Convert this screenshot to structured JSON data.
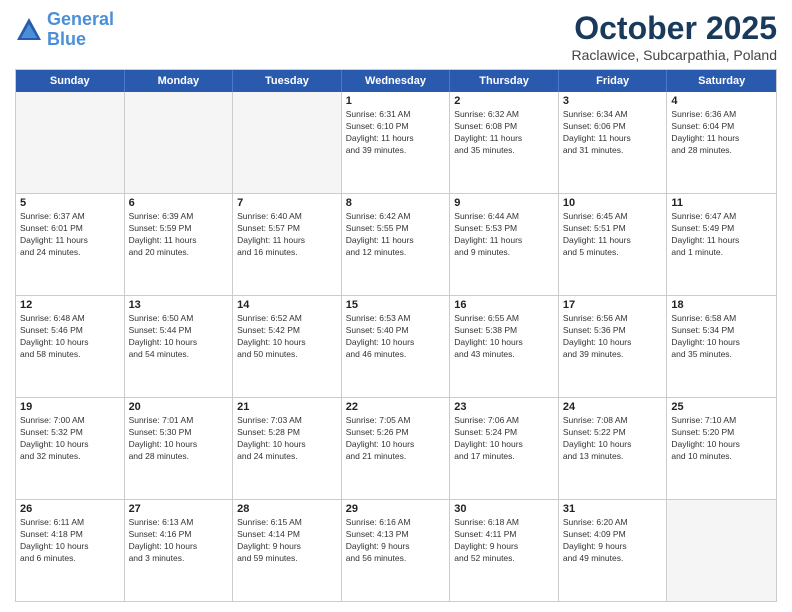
{
  "header": {
    "logo_line1": "General",
    "logo_line2": "Blue",
    "month": "October 2025",
    "location": "Raclawice, Subcarpathia, Poland"
  },
  "days_of_week": [
    "Sunday",
    "Monday",
    "Tuesday",
    "Wednesday",
    "Thursday",
    "Friday",
    "Saturday"
  ],
  "weeks": [
    [
      {
        "day": "",
        "info": "",
        "empty": true
      },
      {
        "day": "",
        "info": "",
        "empty": true
      },
      {
        "day": "",
        "info": "",
        "empty": true
      },
      {
        "day": "1",
        "info": "Sunrise: 6:31 AM\nSunset: 6:10 PM\nDaylight: 11 hours\nand 39 minutes."
      },
      {
        "day": "2",
        "info": "Sunrise: 6:32 AM\nSunset: 6:08 PM\nDaylight: 11 hours\nand 35 minutes."
      },
      {
        "day": "3",
        "info": "Sunrise: 6:34 AM\nSunset: 6:06 PM\nDaylight: 11 hours\nand 31 minutes."
      },
      {
        "day": "4",
        "info": "Sunrise: 6:36 AM\nSunset: 6:04 PM\nDaylight: 11 hours\nand 28 minutes."
      }
    ],
    [
      {
        "day": "5",
        "info": "Sunrise: 6:37 AM\nSunset: 6:01 PM\nDaylight: 11 hours\nand 24 minutes."
      },
      {
        "day": "6",
        "info": "Sunrise: 6:39 AM\nSunset: 5:59 PM\nDaylight: 11 hours\nand 20 minutes."
      },
      {
        "day": "7",
        "info": "Sunrise: 6:40 AM\nSunset: 5:57 PM\nDaylight: 11 hours\nand 16 minutes."
      },
      {
        "day": "8",
        "info": "Sunrise: 6:42 AM\nSunset: 5:55 PM\nDaylight: 11 hours\nand 12 minutes."
      },
      {
        "day": "9",
        "info": "Sunrise: 6:44 AM\nSunset: 5:53 PM\nDaylight: 11 hours\nand 9 minutes."
      },
      {
        "day": "10",
        "info": "Sunrise: 6:45 AM\nSunset: 5:51 PM\nDaylight: 11 hours\nand 5 minutes."
      },
      {
        "day": "11",
        "info": "Sunrise: 6:47 AM\nSunset: 5:49 PM\nDaylight: 11 hours\nand 1 minute."
      }
    ],
    [
      {
        "day": "12",
        "info": "Sunrise: 6:48 AM\nSunset: 5:46 PM\nDaylight: 10 hours\nand 58 minutes."
      },
      {
        "day": "13",
        "info": "Sunrise: 6:50 AM\nSunset: 5:44 PM\nDaylight: 10 hours\nand 54 minutes."
      },
      {
        "day": "14",
        "info": "Sunrise: 6:52 AM\nSunset: 5:42 PM\nDaylight: 10 hours\nand 50 minutes."
      },
      {
        "day": "15",
        "info": "Sunrise: 6:53 AM\nSunset: 5:40 PM\nDaylight: 10 hours\nand 46 minutes."
      },
      {
        "day": "16",
        "info": "Sunrise: 6:55 AM\nSunset: 5:38 PM\nDaylight: 10 hours\nand 43 minutes."
      },
      {
        "day": "17",
        "info": "Sunrise: 6:56 AM\nSunset: 5:36 PM\nDaylight: 10 hours\nand 39 minutes."
      },
      {
        "day": "18",
        "info": "Sunrise: 6:58 AM\nSunset: 5:34 PM\nDaylight: 10 hours\nand 35 minutes."
      }
    ],
    [
      {
        "day": "19",
        "info": "Sunrise: 7:00 AM\nSunset: 5:32 PM\nDaylight: 10 hours\nand 32 minutes."
      },
      {
        "day": "20",
        "info": "Sunrise: 7:01 AM\nSunset: 5:30 PM\nDaylight: 10 hours\nand 28 minutes."
      },
      {
        "day": "21",
        "info": "Sunrise: 7:03 AM\nSunset: 5:28 PM\nDaylight: 10 hours\nand 24 minutes."
      },
      {
        "day": "22",
        "info": "Sunrise: 7:05 AM\nSunset: 5:26 PM\nDaylight: 10 hours\nand 21 minutes."
      },
      {
        "day": "23",
        "info": "Sunrise: 7:06 AM\nSunset: 5:24 PM\nDaylight: 10 hours\nand 17 minutes."
      },
      {
        "day": "24",
        "info": "Sunrise: 7:08 AM\nSunset: 5:22 PM\nDaylight: 10 hours\nand 13 minutes."
      },
      {
        "day": "25",
        "info": "Sunrise: 7:10 AM\nSunset: 5:20 PM\nDaylight: 10 hours\nand 10 minutes."
      }
    ],
    [
      {
        "day": "26",
        "info": "Sunrise: 6:11 AM\nSunset: 4:18 PM\nDaylight: 10 hours\nand 6 minutes."
      },
      {
        "day": "27",
        "info": "Sunrise: 6:13 AM\nSunset: 4:16 PM\nDaylight: 10 hours\nand 3 minutes."
      },
      {
        "day": "28",
        "info": "Sunrise: 6:15 AM\nSunset: 4:14 PM\nDaylight: 9 hours\nand 59 minutes."
      },
      {
        "day": "29",
        "info": "Sunrise: 6:16 AM\nSunset: 4:13 PM\nDaylight: 9 hours\nand 56 minutes."
      },
      {
        "day": "30",
        "info": "Sunrise: 6:18 AM\nSunset: 4:11 PM\nDaylight: 9 hours\nand 52 minutes."
      },
      {
        "day": "31",
        "info": "Sunrise: 6:20 AM\nSunset: 4:09 PM\nDaylight: 9 hours\nand 49 minutes."
      },
      {
        "day": "",
        "info": "",
        "empty": true
      }
    ]
  ]
}
